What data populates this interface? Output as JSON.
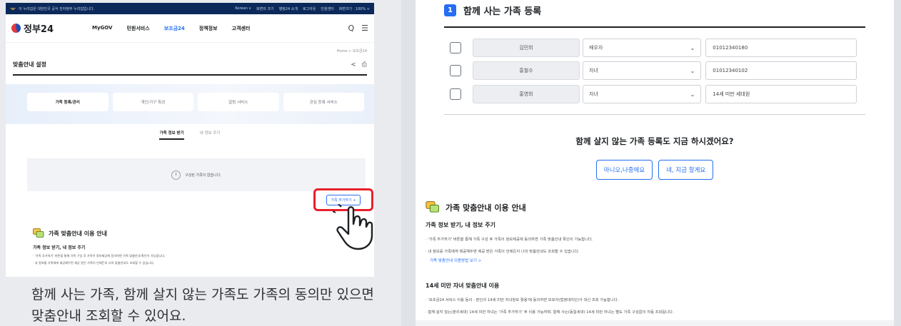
{
  "left": {
    "topbar": {
      "notice": "이 누리집은 대한민국 공식 전자정부 누리집입니다.",
      "links": [
        "Korean ∨",
        "화면의 크기",
        "행정24 소개",
        "로그아웃",
        "민원센터",
        "화면크기 · 100% +"
      ]
    },
    "header": {
      "logo": "정부24",
      "nav": [
        "MyGOV",
        "민원서비스",
        "보조금24",
        "정책정보",
        "고객센터"
      ],
      "active_nav": "보조금24",
      "search_icon": "Q",
      "menu_icon": "☰"
    },
    "breadcrumb": "Home > 보조금24",
    "page_title": "맞춤안내 설정",
    "title_icons": [
      "<",
      "⎙"
    ],
    "tabs": [
      "가족 등록/관리",
      "개인/가구 특성",
      "알림 서비스",
      "관심 등록 서비스"
    ],
    "subtabs": [
      "가족 정보 받기",
      "내 정보 주기"
    ],
    "empty_message": "구성된 가족이 없습니다.",
    "empty_icon": "!",
    "add_button": "가족 추가하기 +",
    "guide_title": "가족 맞춤안내 이용 안내",
    "guide_subtitle": "가족 정보 받기, 내 정보 주기",
    "guide_lines": [
      "· '가족 추가하기' 버튼을 통해 가족 구성 후 가족이 정보제공에 동의하면 가족 맞춤안내 확인이 가능합니다.",
      "· 내 정보를 가족에게 제공해두면 제공 받은 가족이 언제든지 나의 맞춤안내도 조회할 수 있습니다."
    ],
    "caption_line1": "함께 사는 가족, 함께 살지 않는 가족도 가족의 동의만 있으면",
    "caption_line2": "맞춤안내 조회할 수 있어요."
  },
  "right": {
    "step_number": "1",
    "step_title": "함께 사는 가족 등록",
    "members": [
      {
        "name": "김민희",
        "relation": "배우자",
        "phone": "01012340180"
      },
      {
        "name": "홍철수",
        "relation": "자녀",
        "phone": "01012340102"
      },
      {
        "name": "홍영희",
        "relation": "자녀",
        "phone": "14세 미만 세대원"
      }
    ],
    "question": "함께 살지 않는 가족 등록도 지금 하시겠어요?",
    "no_button": "아니오,나중에요",
    "yes_button": "네, 지금 할게요",
    "guide_title": "가족 맞춤안내 이용 안내",
    "sub1": "가족 정보 받기, 내 정보 주기",
    "sub1_lines": [
      "· '가족 추가하기' 버튼을 통해 가족 구성 후 가족이 정보제공에 동의하면 가족 맞춤안내 확인이 가능합니다.",
      "· 내 정보를 가족에게 제공해두면 제공 받은 가족이 언제든지 나의 맞춤안내도 조회할 수 있습니다."
    ],
    "link": "가족 맞춤안내 이용방법 보기 >",
    "sub2": "14세 미만 자녀 맞춤안내 이용",
    "sub2_lines": [
      "· '보조금24 서비스 이용 동의 - 본인의 14세 미만 자녀정보 활용'에 동의하면 보호자(법정대리인)가 대신 조회 가능합니다.",
      "· 함께 살지 않는(분리세대) 14세 미만 자녀는 '가족 추가하기' 후 이용 가능하며, 함께 사는(동일세대) 14세 미만 자녀는 별도 가족 구성없이 자동 조회됩니다."
    ]
  },
  "colors": {
    "accent": "#256ef4",
    "highlight": "#e8202a",
    "navy": "#0b2a5b"
  }
}
